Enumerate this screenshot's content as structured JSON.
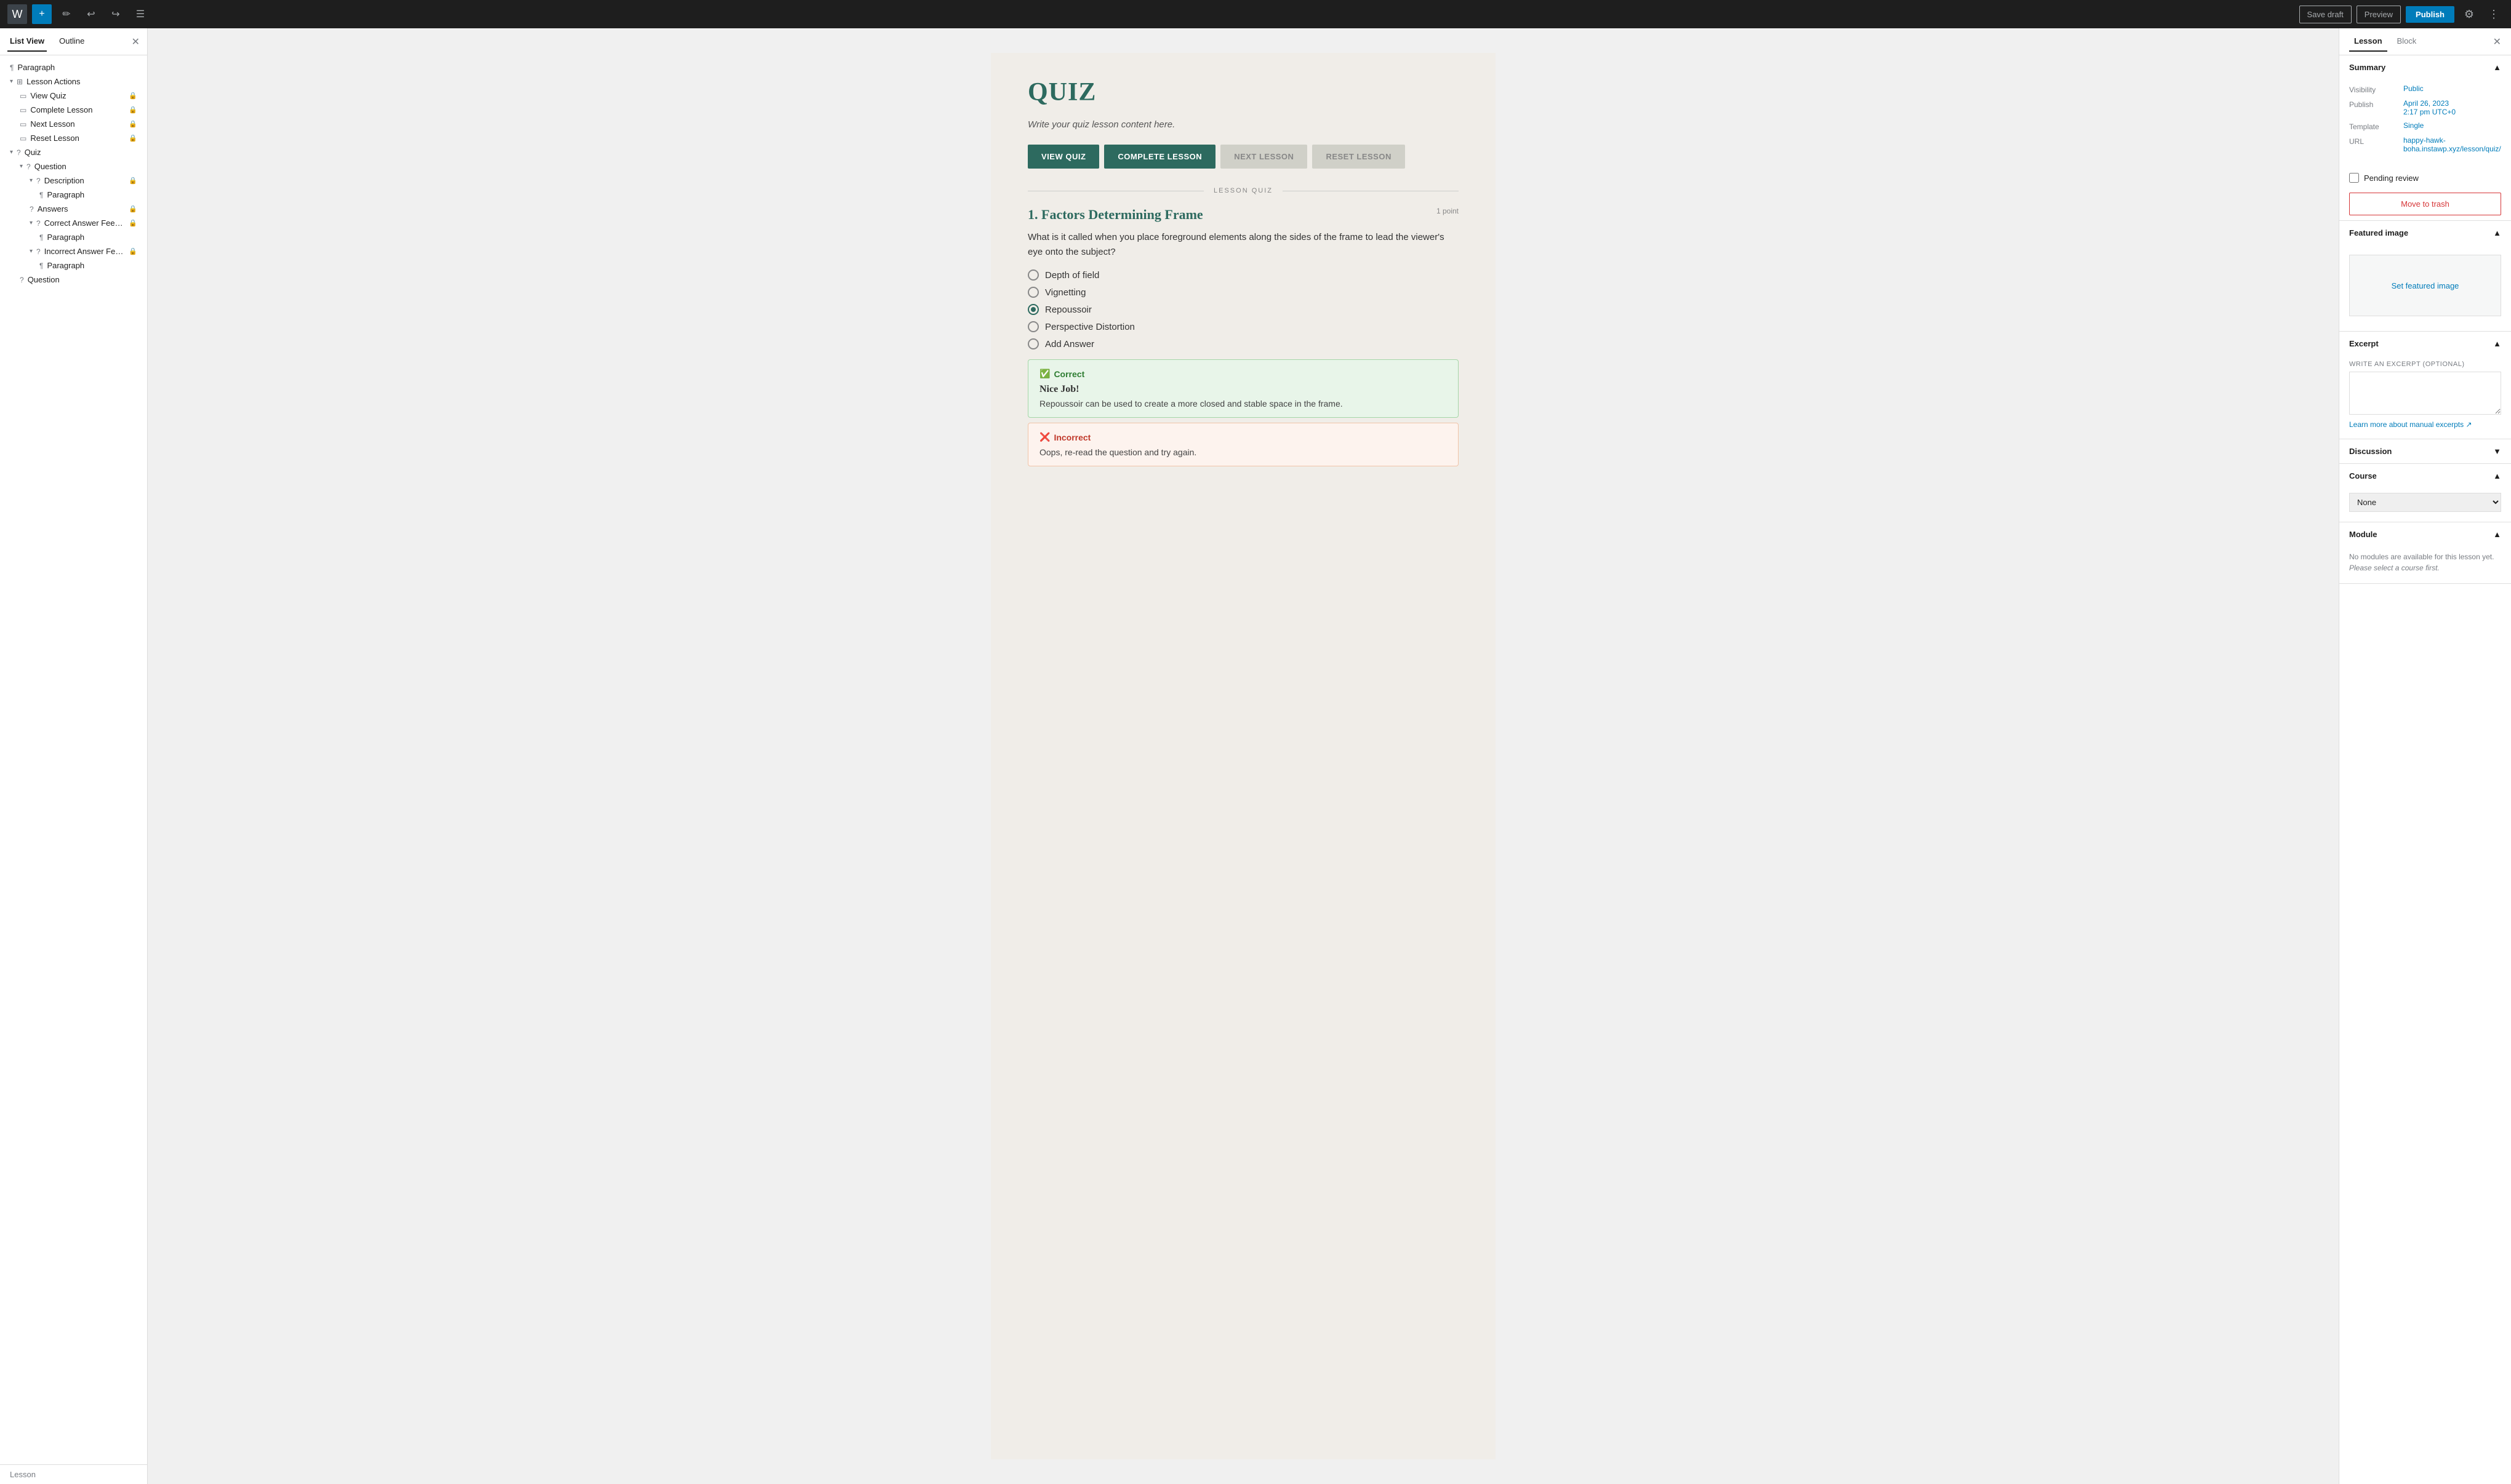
{
  "topbar": {
    "add_label": "+",
    "save_draft_label": "Save draft",
    "preview_label": "Preview",
    "publish_label": "Publish"
  },
  "sidebar": {
    "tab_list": "List View",
    "tab_outline": "Outline",
    "items": [
      {
        "label": "Paragraph",
        "icon": "¶",
        "indent": 0,
        "lock": false,
        "chevron": false
      },
      {
        "label": "Lesson Actions",
        "icon": "⊞",
        "indent": 0,
        "lock": false,
        "chevron": true,
        "expanded": true
      },
      {
        "label": "View Quiz",
        "icon": "▭",
        "indent": 1,
        "lock": true,
        "chevron": false
      },
      {
        "label": "Complete Lesson",
        "icon": "▭",
        "indent": 1,
        "lock": true,
        "chevron": false
      },
      {
        "label": "Next Lesson",
        "icon": "▭",
        "indent": 1,
        "lock": true,
        "chevron": false
      },
      {
        "label": "Reset Lesson",
        "icon": "▭",
        "indent": 1,
        "lock": true,
        "chevron": false
      },
      {
        "label": "Quiz",
        "icon": "?",
        "indent": 0,
        "lock": false,
        "chevron": true,
        "expanded": true
      },
      {
        "label": "Question",
        "icon": "?",
        "indent": 1,
        "lock": false,
        "chevron": true,
        "expanded": true
      },
      {
        "label": "Description",
        "icon": "?",
        "indent": 2,
        "lock": true,
        "chevron": true,
        "expanded": true
      },
      {
        "label": "Paragraph",
        "icon": "¶",
        "indent": 3,
        "lock": false,
        "chevron": false
      },
      {
        "label": "Answers",
        "icon": "?",
        "indent": 2,
        "lock": true,
        "chevron": false
      },
      {
        "label": "Correct Answer Feedback",
        "icon": "?",
        "indent": 2,
        "lock": true,
        "chevron": true,
        "expanded": true
      },
      {
        "label": "Paragraph",
        "icon": "¶",
        "indent": 3,
        "lock": false,
        "chevron": false
      },
      {
        "label": "Incorrect Answer Feedba...",
        "icon": "?",
        "indent": 2,
        "lock": true,
        "chevron": true,
        "expanded": true
      },
      {
        "label": "Paragraph",
        "icon": "¶",
        "indent": 3,
        "lock": false,
        "chevron": false
      },
      {
        "label": "Question",
        "icon": "?",
        "indent": 1,
        "lock": false,
        "chevron": false
      }
    ],
    "footer": "Lesson"
  },
  "editor": {
    "quiz_title": "QUIZ",
    "quiz_subtitle": "Write your quiz lesson content here.",
    "btn_view_quiz": "VIEW QUIZ",
    "btn_complete_lesson": "COMPLETE LESSON",
    "btn_next_lesson": "NEXT LESSON",
    "btn_reset_lesson": "RESET LESSON",
    "lesson_quiz_label": "LESSON QUIZ",
    "question_number": "1.",
    "question_title": "Factors Determining Frame",
    "question_points": "1 point",
    "question_text": "What is it called when you place foreground elements along the sides of the frame to lead the viewer's eye onto the subject?",
    "answers": [
      {
        "text": "Depth of field",
        "selected": false
      },
      {
        "text": "Vignetting",
        "selected": false
      },
      {
        "text": "Repoussoir",
        "selected": true
      },
      {
        "text": "Perspective Distortion",
        "selected": false
      },
      {
        "text": "Add Answer",
        "selected": false
      }
    ],
    "correct_label": "Correct",
    "correct_title": "Nice Job!",
    "correct_text": "Repoussoir can be used to create a more closed and stable space in the frame.",
    "incorrect_label": "Incorrect",
    "incorrect_text": "Oops, re-read the question and try again."
  },
  "right_panel": {
    "tab_lesson": "Lesson",
    "tab_block": "Block",
    "summary_label": "Summary",
    "visibility_label": "Visibility",
    "visibility_value": "Public",
    "publish_label": "Publish",
    "publish_value_line1": "April 26, 2023",
    "publish_value_line2": "2:17 pm UTC+0",
    "template_label": "Template",
    "template_value": "Single",
    "url_label": "URL",
    "url_value": "happy-hawk-boha.instawp.xyz/lesson/quiz/",
    "pending_label": "Pending review",
    "move_trash_label": "Move to trash",
    "featured_image_label": "Featured image",
    "set_featured_image_label": "Set featured image",
    "excerpt_label": "Excerpt",
    "write_excerpt_label": "WRITE AN EXCERPT (OPTIONAL)",
    "excerpt_link_text": "Learn more about manual excerpts ↗",
    "discussion_label": "Discussion",
    "course_label": "Course",
    "course_value": "None",
    "module_label": "Module",
    "module_text": "No modules are available for this lesson yet. ",
    "module_italic": "Please select a course first."
  }
}
